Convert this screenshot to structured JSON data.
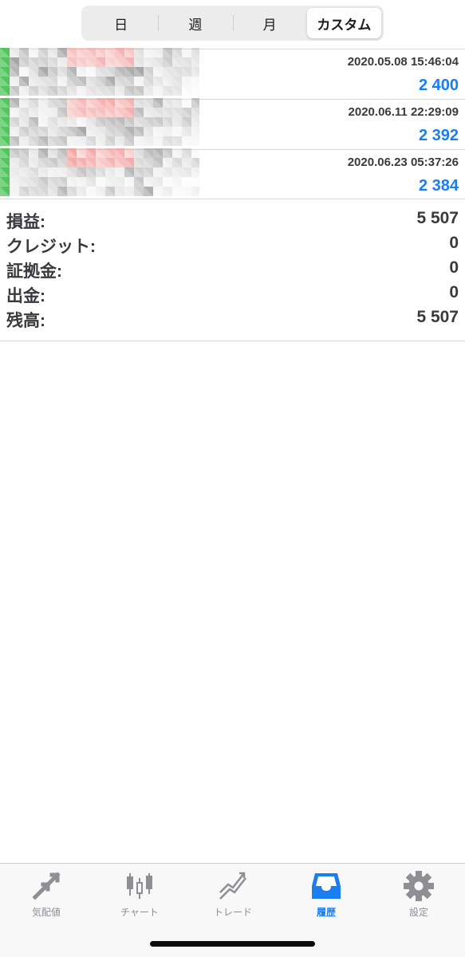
{
  "period_tabs": [
    {
      "label": "日",
      "active": false
    },
    {
      "label": "週",
      "active": false
    },
    {
      "label": "月",
      "active": false
    },
    {
      "label": "カスタム",
      "active": true
    }
  ],
  "deals": [
    {
      "date": "2020.05.08 15:46:04",
      "profit": "2 400"
    },
    {
      "date": "2020.06.11 22:29:09",
      "profit": "2 392"
    },
    {
      "date": "2020.06.23 05:37:26",
      "profit": "2 384"
    }
  ],
  "summary": [
    {
      "label": "損益:",
      "value": "5 507"
    },
    {
      "label": "クレジット:",
      "value": "0"
    },
    {
      "label": "証拠金:",
      "value": "0"
    },
    {
      "label": "出金:",
      "value": "0"
    },
    {
      "label": "残高:",
      "value": "5 507"
    }
  ],
  "tabbar": [
    {
      "label": "気配値",
      "icon": "quotes-arrows-icon",
      "active": false
    },
    {
      "label": "チャート",
      "icon": "candlestick-chart-icon",
      "active": false
    },
    {
      "label": "トレード",
      "icon": "trade-trend-icon",
      "active": false
    },
    {
      "label": "履歴",
      "icon": "history-inbox-icon",
      "active": true
    },
    {
      "label": "設定",
      "icon": "settings-gear-icon",
      "active": false
    }
  ],
  "colors": {
    "accent": "#1a7ef0",
    "text": "#3a3a3c",
    "inactive": "#8e8e93",
    "pixel_green": "#3fbf4a",
    "pixel_red": "#f08a8a"
  }
}
